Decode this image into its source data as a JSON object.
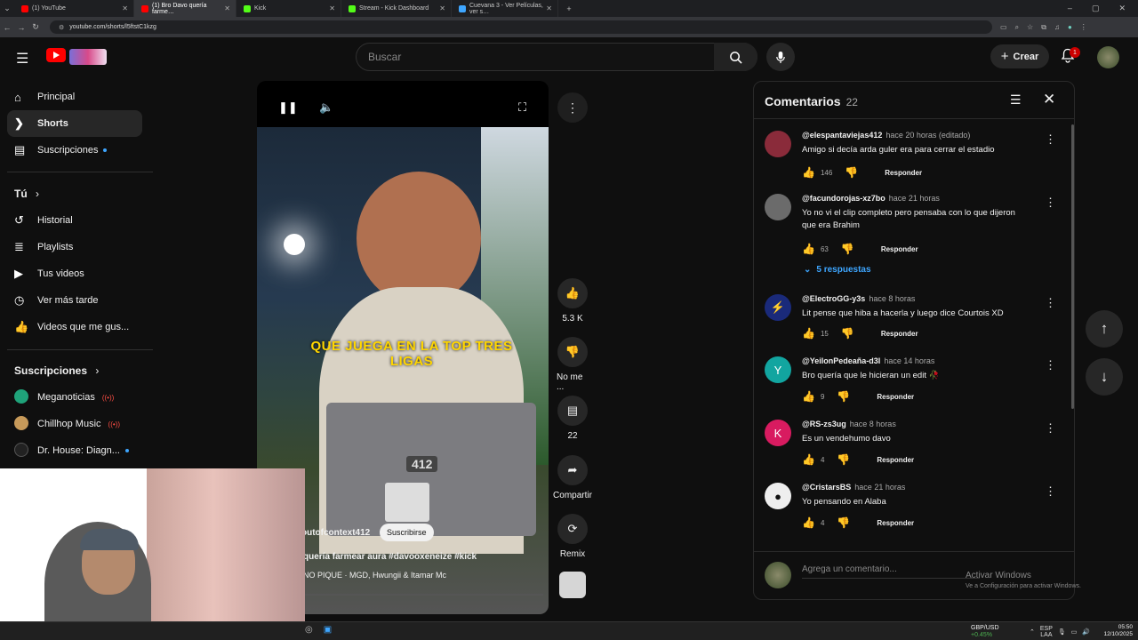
{
  "browser": {
    "tabs": [
      {
        "label": "(1) YouTube",
        "active": false,
        "color": "#ff0000"
      },
      {
        "label": "(1) Bro Davo quería farme…",
        "active": true,
        "color": "#ff0000"
      },
      {
        "label": "Kick",
        "active": false,
        "color": "#53fc18"
      },
      {
        "label": "Stream - Kick Dashboard",
        "active": false,
        "color": "#53fc18"
      },
      {
        "label": "Cuevana 3 - Ver Películas, ver s…",
        "active": false,
        "color": "#3ea6ff"
      }
    ],
    "url": "youtube.com/shorts/l5ftstC1kzg"
  },
  "header": {
    "search_placeholder": "Buscar",
    "create_label": "Crear",
    "notifications_count": "1"
  },
  "sidebar": {
    "main": [
      {
        "label": "Principal",
        "icon": "home-icon",
        "glyph": "⌂"
      },
      {
        "label": "Shorts",
        "icon": "shorts-icon",
        "glyph": "❯"
      },
      {
        "label": "Suscripciones",
        "icon": "subscriptions-icon",
        "glyph": "▤"
      }
    ],
    "you_title": "Tú",
    "you": [
      {
        "label": "Historial",
        "icon": "history-icon",
        "glyph": "↺"
      },
      {
        "label": "Playlists",
        "icon": "playlists-icon",
        "glyph": "≣"
      },
      {
        "label": "Tus videos",
        "icon": "your-videos-icon",
        "glyph": "▶"
      },
      {
        "label": "Ver más tarde",
        "icon": "watch-later-icon",
        "glyph": "◷"
      },
      {
        "label": "Videos que me gus...",
        "icon": "liked-videos-icon",
        "glyph": "👍"
      }
    ],
    "subs_title": "Suscripciones",
    "subs": [
      {
        "label": "Meganoticias",
        "color": "#1fa37a"
      },
      {
        "label": "Chillhop Music",
        "color": "#c79a5a"
      },
      {
        "label": "Dr. House: Diagn...",
        "color": "#222222"
      }
    ]
  },
  "video": {
    "caption": "QUE JUEGA EN LA TOP TRES LIGAS",
    "laptop_sticker": "412",
    "channel": "outofcontext412",
    "subscribe_label": "Suscribirse",
    "title": "quería farmear aura  #davooxeneize #kick",
    "music": "NO PIQUE · MGD, Hwungii & Itamar Mc"
  },
  "actions": {
    "likes": "5.3 K",
    "dislike": "No me ...",
    "comments": "22",
    "share": "Compartir",
    "remix": "Remix"
  },
  "comments_panel": {
    "title": "Comentarios",
    "count": "22",
    "reply_label": "Responder",
    "replies_toggle": "5 respuestas",
    "input_placeholder": "Agrega un comentario...",
    "items": [
      {
        "user": "@elespantaviejas412",
        "time": "hace 20 horas (editado)",
        "text": "Amigo si decía arda guler era para cerrar el estadio",
        "likes": "146",
        "avatar_color": "#8a2b3a",
        "initial": ""
      },
      {
        "user": "@facundorojas-xz7bo",
        "time": "hace 21 horas",
        "text": "Yo no vi el clip completo pero pensaba con lo que dijeron que era Brahim",
        "likes": "63",
        "avatar_color": "#6b6b6b",
        "initial": ""
      },
      {
        "user": "@ElectroGG-y3s",
        "time": "hace 8 horas",
        "text": "Lit pense que hiba a hacerla y luego dice Courtois XD",
        "likes": "15",
        "avatar_color": "#1a2a7a",
        "initial": ""
      },
      {
        "user": "@YeilonPedeaña-d3l",
        "time": "hace 14 horas",
        "text": "Bro quería que le hicieran un edit 🥀",
        "likes": "9",
        "avatar_color": "#12a5a0",
        "initial": "Y"
      },
      {
        "user": "@RS-zs3ug",
        "time": "hace 8 horas",
        "text": "Es un vendehumo davo",
        "likes": "4",
        "avatar_color": "#d81b60",
        "initial": "K"
      },
      {
        "user": "@CristarsBS",
        "time": "hace 21 horas",
        "text": "Yo pensando en Alaba",
        "likes": "4",
        "avatar_color": "#eeeeee",
        "initial": ""
      }
    ]
  },
  "watermark": {
    "title": "Activar Windows",
    "subtitle": "Ve a Configuración para activar Windows."
  },
  "taskbar": {
    "ticker_name": "GBP/USD",
    "ticker_change": "+0.45%",
    "lang": "ESP",
    "lang2": "LAA",
    "time": "05:50",
    "date": "12/10/2025"
  }
}
